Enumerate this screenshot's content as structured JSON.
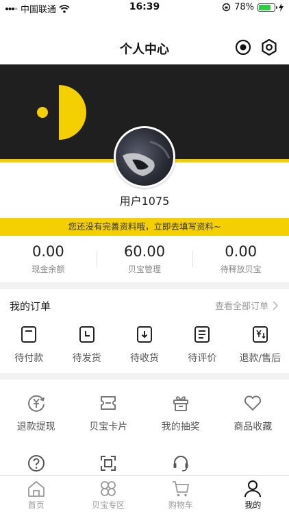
{
  "status_bar": {
    "carrier": "中国联通",
    "time": "16:39",
    "battery_percent": "78%",
    "battery_level": 0.78
  },
  "header": {
    "title": "个人中心",
    "message_icon": "message-icon",
    "settings_icon": "settings-icon"
  },
  "profile": {
    "username": "用户1075"
  },
  "notice": {
    "text": "您还没有完善资料哦，立即去填写资料~"
  },
  "stats": [
    {
      "value": "0.00",
      "label": "现金余额"
    },
    {
      "value": "60.00",
      "label": "贝宝管理"
    },
    {
      "value": "0.00",
      "label": "待释放贝宝"
    }
  ],
  "orders": {
    "title": "我的订单",
    "view_all": "查看全部订单",
    "items": [
      {
        "label": "待付款",
        "icon": "wallet-icon"
      },
      {
        "label": "待发货",
        "icon": "clock-icon"
      },
      {
        "label": "待收货",
        "icon": "download-icon"
      },
      {
        "label": "待评价",
        "icon": "document-icon"
      },
      {
        "label": "退款/售后",
        "icon": "refund-icon"
      }
    ]
  },
  "tools": {
    "row1": [
      {
        "label": "退款提现",
        "icon": "yen-refresh-icon"
      },
      {
        "label": "贝宝卡片",
        "icon": "ticket-icon"
      },
      {
        "label": "我的抽奖",
        "icon": "gift-icon"
      },
      {
        "label": "商品收藏",
        "icon": "heart-icon"
      }
    ],
    "row2": [
      {
        "label": "",
        "icon": "help-icon"
      },
      {
        "label": "",
        "icon": "scan-icon"
      },
      {
        "label": "",
        "icon": "headset-icon"
      }
    ]
  },
  "tabbar": [
    {
      "label": "首页",
      "icon": "home-icon",
      "active": false
    },
    {
      "label": "贝宝专区",
      "icon": "clover-icon",
      "active": false
    },
    {
      "label": "购物车",
      "icon": "cart-icon",
      "active": false
    },
    {
      "label": "我的",
      "icon": "person-icon",
      "active": true
    }
  ],
  "colors": {
    "accent": "#f5d000",
    "banner": "#1f1f1f",
    "active_tab": "#111111",
    "inactive_tab": "#999999"
  }
}
